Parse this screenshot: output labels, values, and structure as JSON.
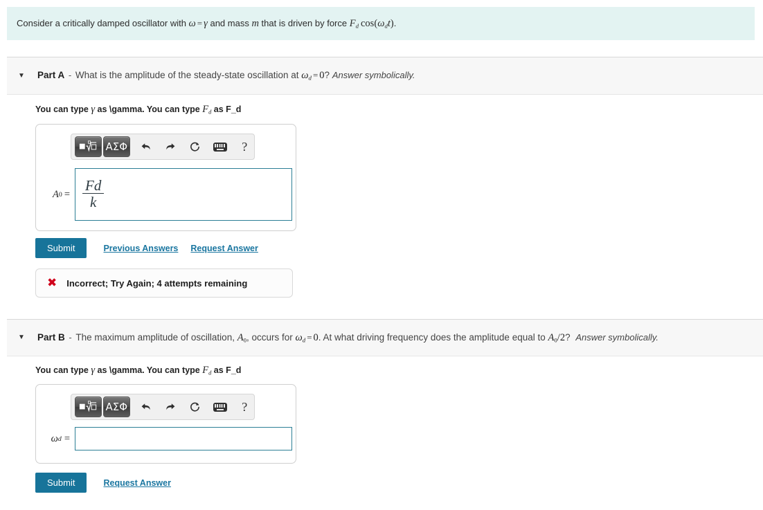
{
  "intro": {
    "text_before_omega": "Consider a critically damped oscillator with ",
    "omega": "ω",
    "equals": "=",
    "gamma": "γ",
    "text_mid": " and mass ",
    "mass": "m",
    "text_after_mass": " that is driven by force ",
    "force_F": "F",
    "force_sub": "d",
    "cos": "cos",
    "open_paren": "(",
    "omega_d": "ω",
    "omega_d_sub": "d",
    "t": "t",
    "close_paren": ")",
    "period": "."
  },
  "parts": [
    {
      "caret": "▼",
      "label": "Part A",
      "dash": "-",
      "question_prefix": "What is the amplitude of the steady-state oscillation at ",
      "q_omega": "ω",
      "q_omega_sub": "d",
      "q_equals": "=",
      "q_value": "0",
      "question_suffix": "? ",
      "italic_note": "Answer symbolically.",
      "hint_prefix": "You can type ",
      "hint_gamma": "γ",
      "hint_mid": " as \\gamma. You can type ",
      "hint_F": "F",
      "hint_F_sub": "d",
      "hint_suffix": " as F_d",
      "answer_label_var": "A",
      "answer_label_sub": "0",
      "answer_label_eq": "=",
      "answer_value_numerator": "Fd",
      "answer_value_denominator": "k",
      "answer_placeholder": "",
      "submit_label": "Submit",
      "links": [
        "Previous Answers",
        "Request Answer"
      ],
      "feedback": {
        "icon": "✖",
        "text": "Incorrect; Try Again; 4 attempts remaining"
      },
      "toolbar": {
        "template_button": "template-radical",
        "greek_button": "ΑΣΦ",
        "undo": "undo-arrow",
        "redo": "redo-arrow",
        "reset": "↻",
        "keyboard": "keyboard",
        "help": "?"
      }
    },
    {
      "caret": "▼",
      "label": "Part B",
      "dash": "-",
      "question_prefix": "The maximum amplitude of oscillation, ",
      "q_A": "A",
      "q_A_sub": "0",
      "question_mid": ", occurs for ",
      "q_omega": "ω",
      "q_omega_sub": "d",
      "q_equals": "=",
      "q_value": "0",
      "question_mid2": ". At what driving frequency does the amplitude equal to ",
      "q_A2": "A",
      "q_A2_sub": "0",
      "q_slash": "/",
      "q_two": "2",
      "question_suffix": "? ",
      "italic_note": "Answer symbolically.",
      "hint_prefix": "You can type ",
      "hint_gamma": "γ",
      "hint_mid": " as \\gamma. You can type ",
      "hint_F": "F",
      "hint_F_sub": "d",
      "hint_suffix": " as F_d",
      "answer_label_var": "ω",
      "answer_label_sub": "d",
      "answer_label_eq": "=",
      "answer_value": "",
      "submit_label": "Submit",
      "links": [
        "Request Answer"
      ],
      "toolbar": {
        "template_button": "template-radical",
        "greek_button": "ΑΣΦ",
        "undo": "undo-arrow",
        "redo": "redo-arrow",
        "reset": "↻",
        "keyboard": "keyboard",
        "help": "?"
      }
    }
  ],
  "colors": {
    "banner_bg": "#e3f3f2",
    "header_bg": "#f7f7f7",
    "submit_bg": "#17749a",
    "link": "#1a76a0",
    "input_border": "#2b7e95",
    "error": "#d0021b"
  }
}
